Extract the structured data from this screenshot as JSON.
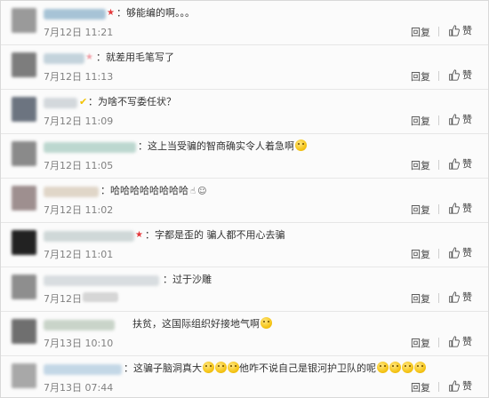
{
  "comments": [
    {
      "text": "：够能编的啊。。。",
      "date": "7月12日",
      "time": "11:21",
      "emoji": [],
      "icon": "",
      "badge": "star"
    },
    {
      "text": "：就差用毛笔写了",
      "date": "7月12日",
      "time": "11:13",
      "emoji": [],
      "icon": "",
      "badge": ""
    },
    {
      "text": "：为啥不写委任状？",
      "date": "7月12日",
      "time": "11:09",
      "emoji": [],
      "icon": "",
      "badge": ""
    },
    {
      "text": "：这上当受骗的智商确实令人着急啊",
      "date": "7月12日",
      "time": "11:05",
      "emoji": [
        "emoji-face"
      ],
      "icon": "",
      "badge": ""
    },
    {
      "text": "：哈哈哈哈哈哈哈哈",
      "date": "7月12日",
      "time": "11:02",
      "emoji": [],
      "icon": "hand-icon",
      "badge": ""
    },
    {
      "text": "：字都是歪的 骗人都不用心去骗",
      "date": "7月12日",
      "time": "11:01",
      "emoji": [],
      "icon": "",
      "badge": "star"
    },
    {
      "text": "：过于沙雕",
      "date": "7月12日",
      "time": "",
      "emoji": [],
      "icon": "",
      "badge": ""
    },
    {
      "text": "扶贫，这国际组织好接地气啊",
      "date": "7月13日",
      "time": "10:10",
      "emoji": [
        "emoji-face"
      ],
      "icon": "",
      "badge": ""
    },
    {
      "text": "：这骗子脑洞真大",
      "text2": "他咋不说自己是银河护卫队的呢",
      "date": "7月13日",
      "time": "07:44",
      "emoji": [
        "emoji-face",
        "emoji-face",
        "emoji-face"
      ],
      "emoji2": [
        "emoji-face",
        "emoji-face",
        "emoji-face",
        "emoji-face"
      ],
      "icon": "",
      "badge": ""
    }
  ],
  "actions": {
    "reply": "回复",
    "like": "赞"
  }
}
